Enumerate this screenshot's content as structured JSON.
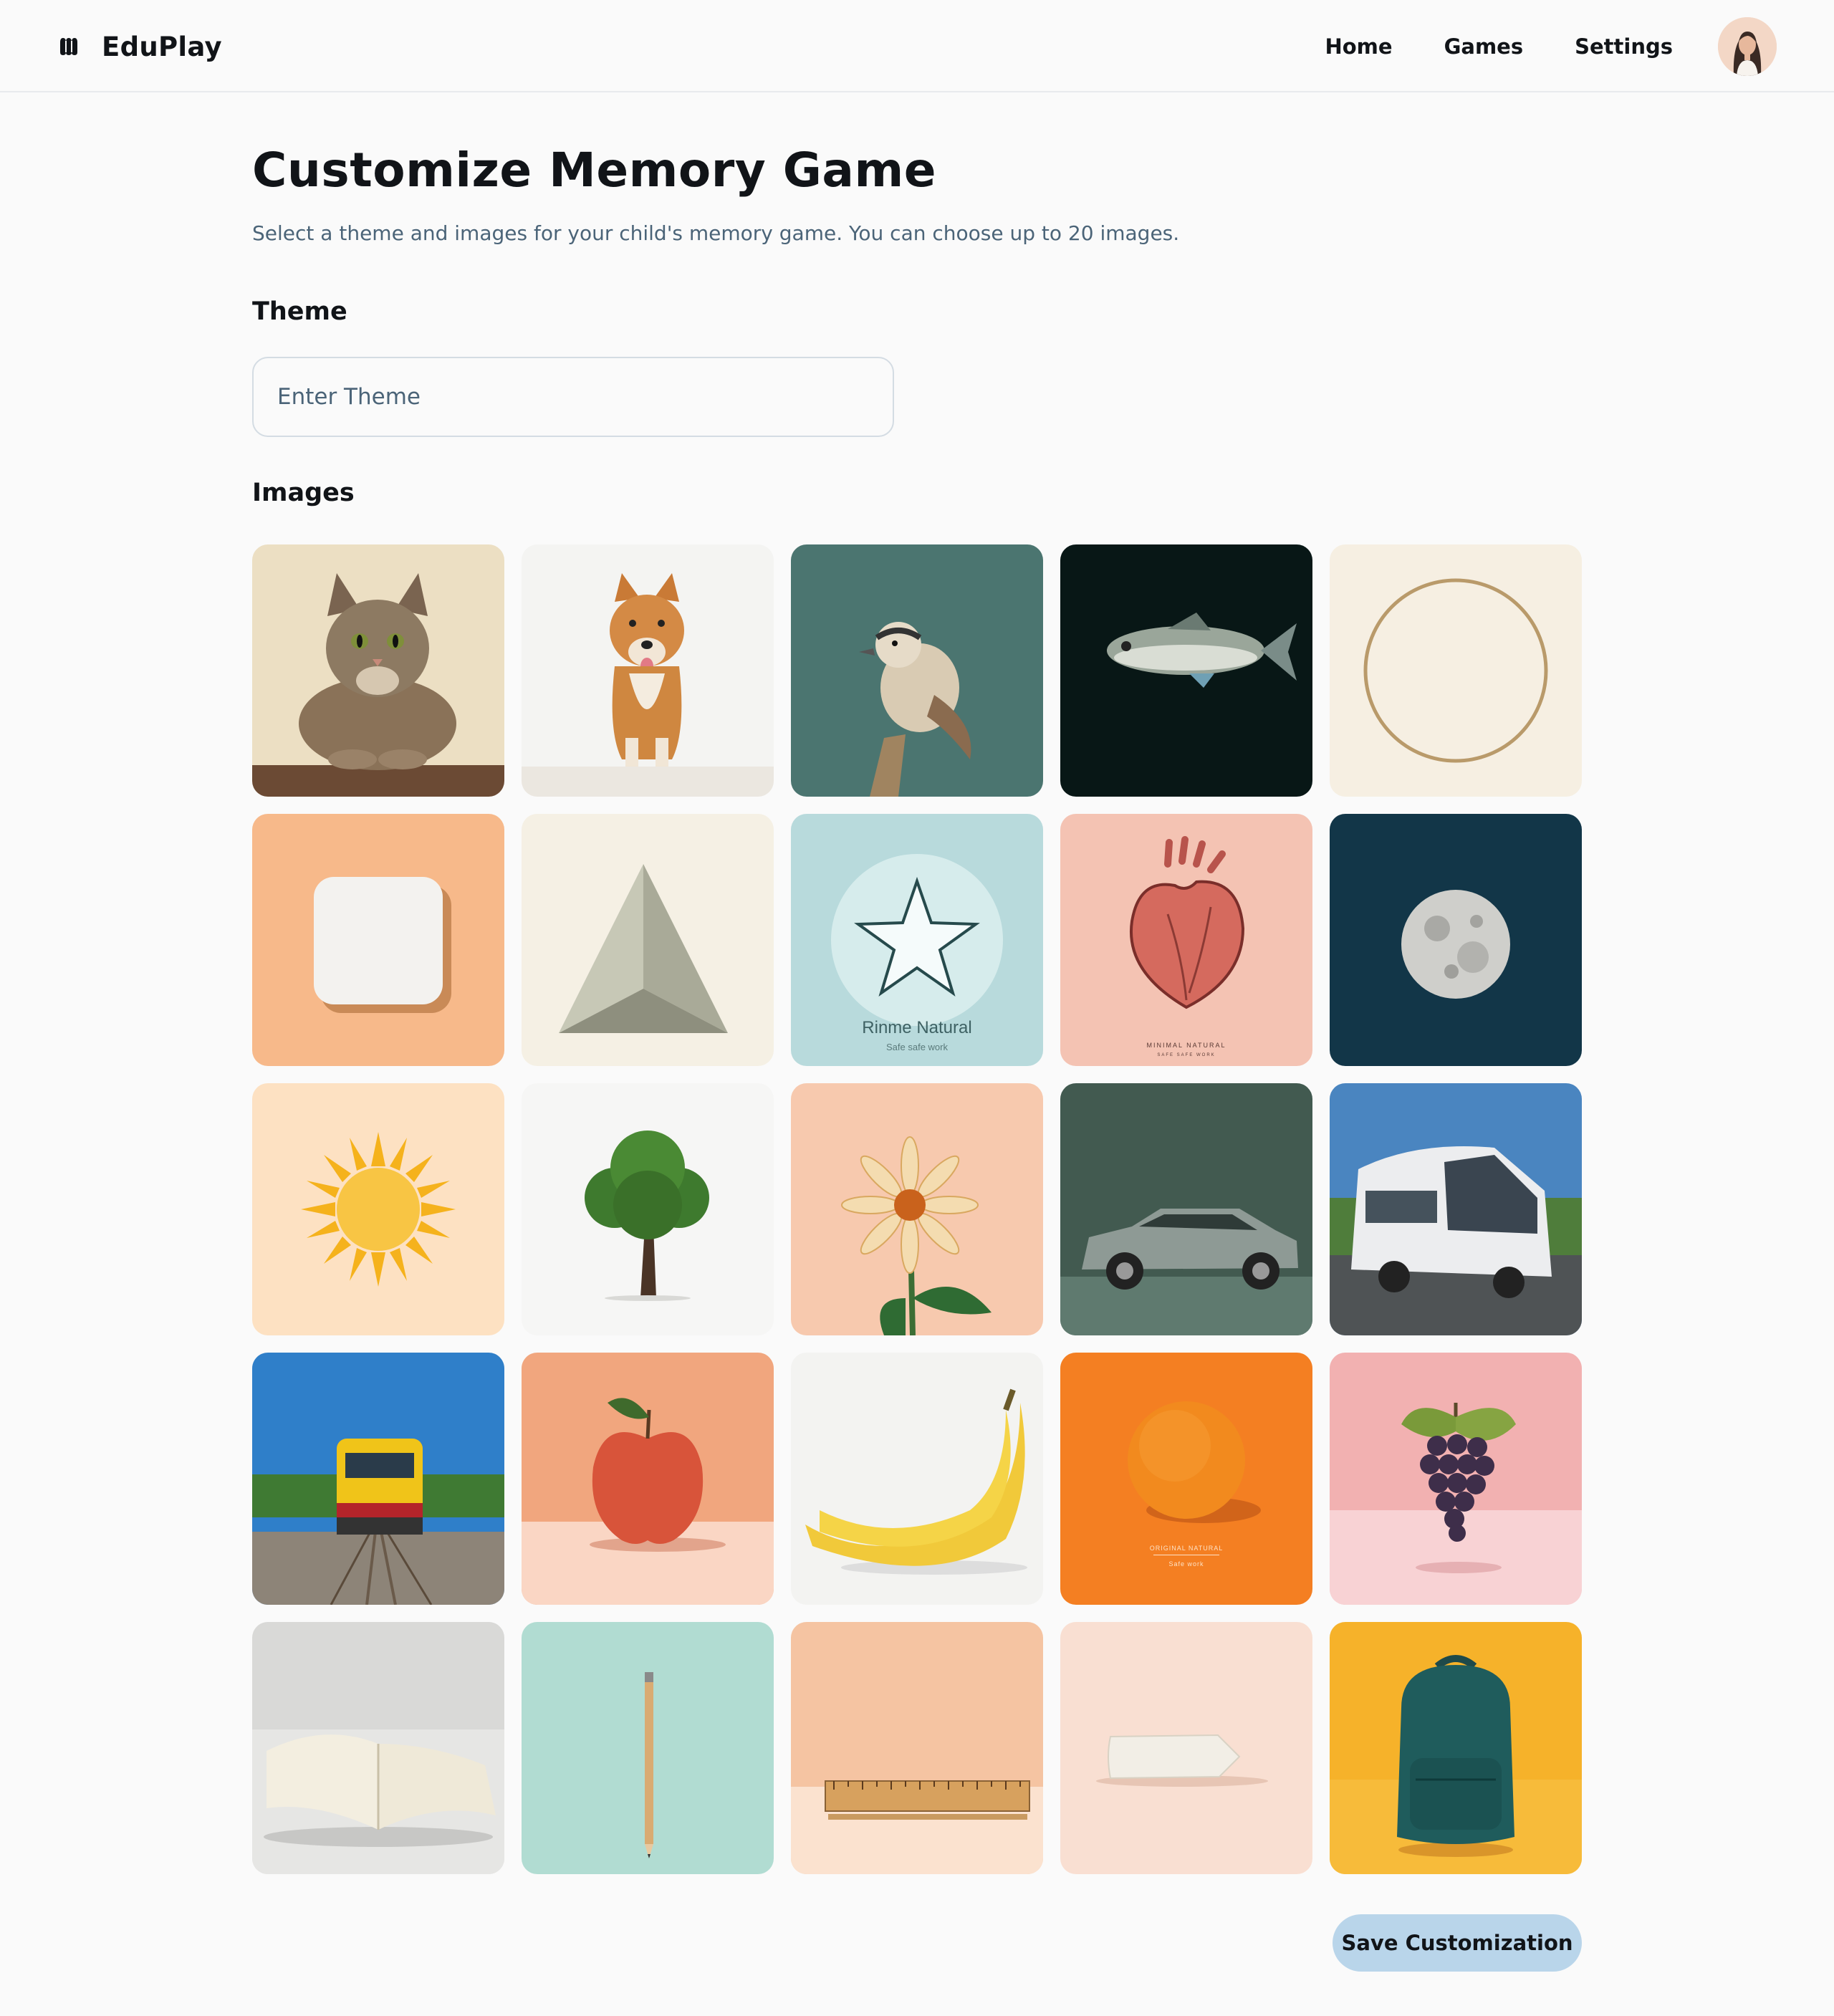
{
  "app": {
    "name": "EduPlay"
  },
  "nav": {
    "home": "Home",
    "games": "Games",
    "settings": "Settings"
  },
  "page": {
    "title": "Customize Memory Game",
    "subtitle": "Select a theme and images for your child's memory game. You can choose up to 20 images."
  },
  "theme": {
    "heading": "Theme",
    "placeholder": "Enter Theme",
    "value": ""
  },
  "images": {
    "heading": "Images",
    "items": [
      {
        "subject": "cat",
        "background": "#e9dcc0"
      },
      {
        "subject": "dog",
        "background": "#f4f4f2"
      },
      {
        "subject": "bird",
        "background": "#4b7570"
      },
      {
        "subject": "fish",
        "background": "#0a1a1a"
      },
      {
        "subject": "circle",
        "background": "#f6efe2"
      },
      {
        "subject": "square",
        "background": "#f7b98a"
      },
      {
        "subject": "triangle",
        "background": "#f5f0e4"
      },
      {
        "subject": "star",
        "background": "#b8dadc",
        "caption": "Rinme Natural",
        "subcaption": "Safe safe work"
      },
      {
        "subject": "heart",
        "background": "#f4c3b3",
        "caption": "MINIMAL NATURAL",
        "subcaption": "SAFE SAFE WORK"
      },
      {
        "subject": "moon",
        "background": "#123648"
      },
      {
        "subject": "sun",
        "background": "#fde1c2"
      },
      {
        "subject": "tree",
        "background": "#f6f6f5"
      },
      {
        "subject": "flower",
        "background": "#f7c9ae"
      },
      {
        "subject": "car",
        "background": "#425a50"
      },
      {
        "subject": "bus",
        "background": "#6b8fb0"
      },
      {
        "subject": "train",
        "background": "#2f7fc9"
      },
      {
        "subject": "apple",
        "background": "#f1a67e"
      },
      {
        "subject": "banana",
        "background": "#f3f3f1"
      },
      {
        "subject": "orange",
        "background": "#f47f22",
        "caption": "ORIGINAL NATURAL",
        "subcaption": "Safe work"
      },
      {
        "subject": "grapes",
        "background": "#f2b1b1"
      },
      {
        "subject": "book",
        "background": "#d9d9d7"
      },
      {
        "subject": "pencil",
        "background": "#b1dcd2"
      },
      {
        "subject": "ruler",
        "background": "#f5c4a2"
      },
      {
        "subject": "eraser",
        "background": "#f9dfd2"
      },
      {
        "subject": "backpack",
        "background": "#f6b22a"
      }
    ]
  },
  "actions": {
    "save": "Save Customization"
  },
  "colors": {
    "accent_button": "#b9d5ea",
    "subtitle_text": "#4b6478",
    "border": "#d4dce3"
  }
}
